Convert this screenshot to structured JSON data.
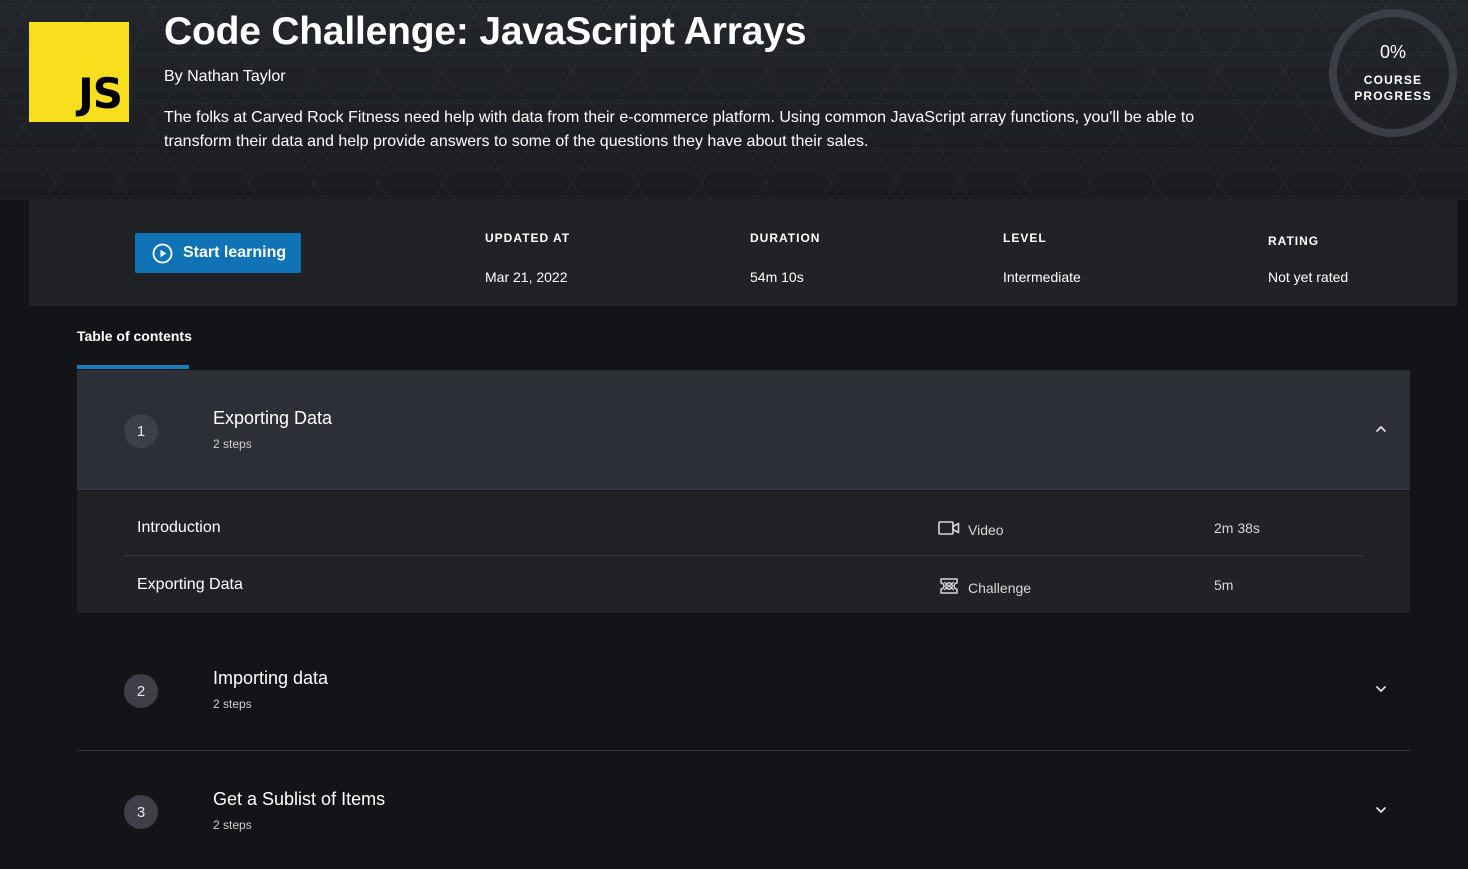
{
  "course": {
    "logo_text": "JS",
    "title": "Code Challenge: JavaScript Arrays",
    "author": "By Nathan Taylor",
    "description": "The folks at Carved Rock Fitness need help with data from their e-commerce platform. Using common JavaScript array functions, you'll be able to transform their data and help provide answers to some of the questions they have about their sales."
  },
  "progress": {
    "percent_label": "0%",
    "percent_value": 0,
    "label_line1": "COURSE",
    "label_line2": "PROGRESS"
  },
  "info": {
    "start_label": "Start learning",
    "updated_heading": "UPDATED AT",
    "updated_value": "Mar 21, 2022",
    "duration_heading": "DURATION",
    "duration_value": "54m 10s",
    "level_heading": "LEVEL",
    "level_value": "Intermediate",
    "rating_heading": "RATING",
    "rating_value": "Not yet rated"
  },
  "tabs": {
    "toc": "Table of contents"
  },
  "modules": [
    {
      "number": "1",
      "title": "Exporting Data",
      "steps_label": "2 steps",
      "expanded": true,
      "steps": [
        {
          "title": "Introduction",
          "type": "Video",
          "type_icon": "video-icon",
          "duration": "2m 38s"
        },
        {
          "title": "Exporting Data",
          "type": "Challenge",
          "type_icon": "challenge-icon",
          "duration": "5m"
        }
      ]
    },
    {
      "number": "2",
      "title": "Importing data",
      "steps_label": "2 steps",
      "expanded": false
    },
    {
      "number": "3",
      "title": "Get a Sublist of Items",
      "steps_label": "2 steps",
      "expanded": false
    }
  ],
  "colors": {
    "accent": "#0f73b5",
    "js_yellow": "#f7df1e",
    "background": "#131417"
  }
}
